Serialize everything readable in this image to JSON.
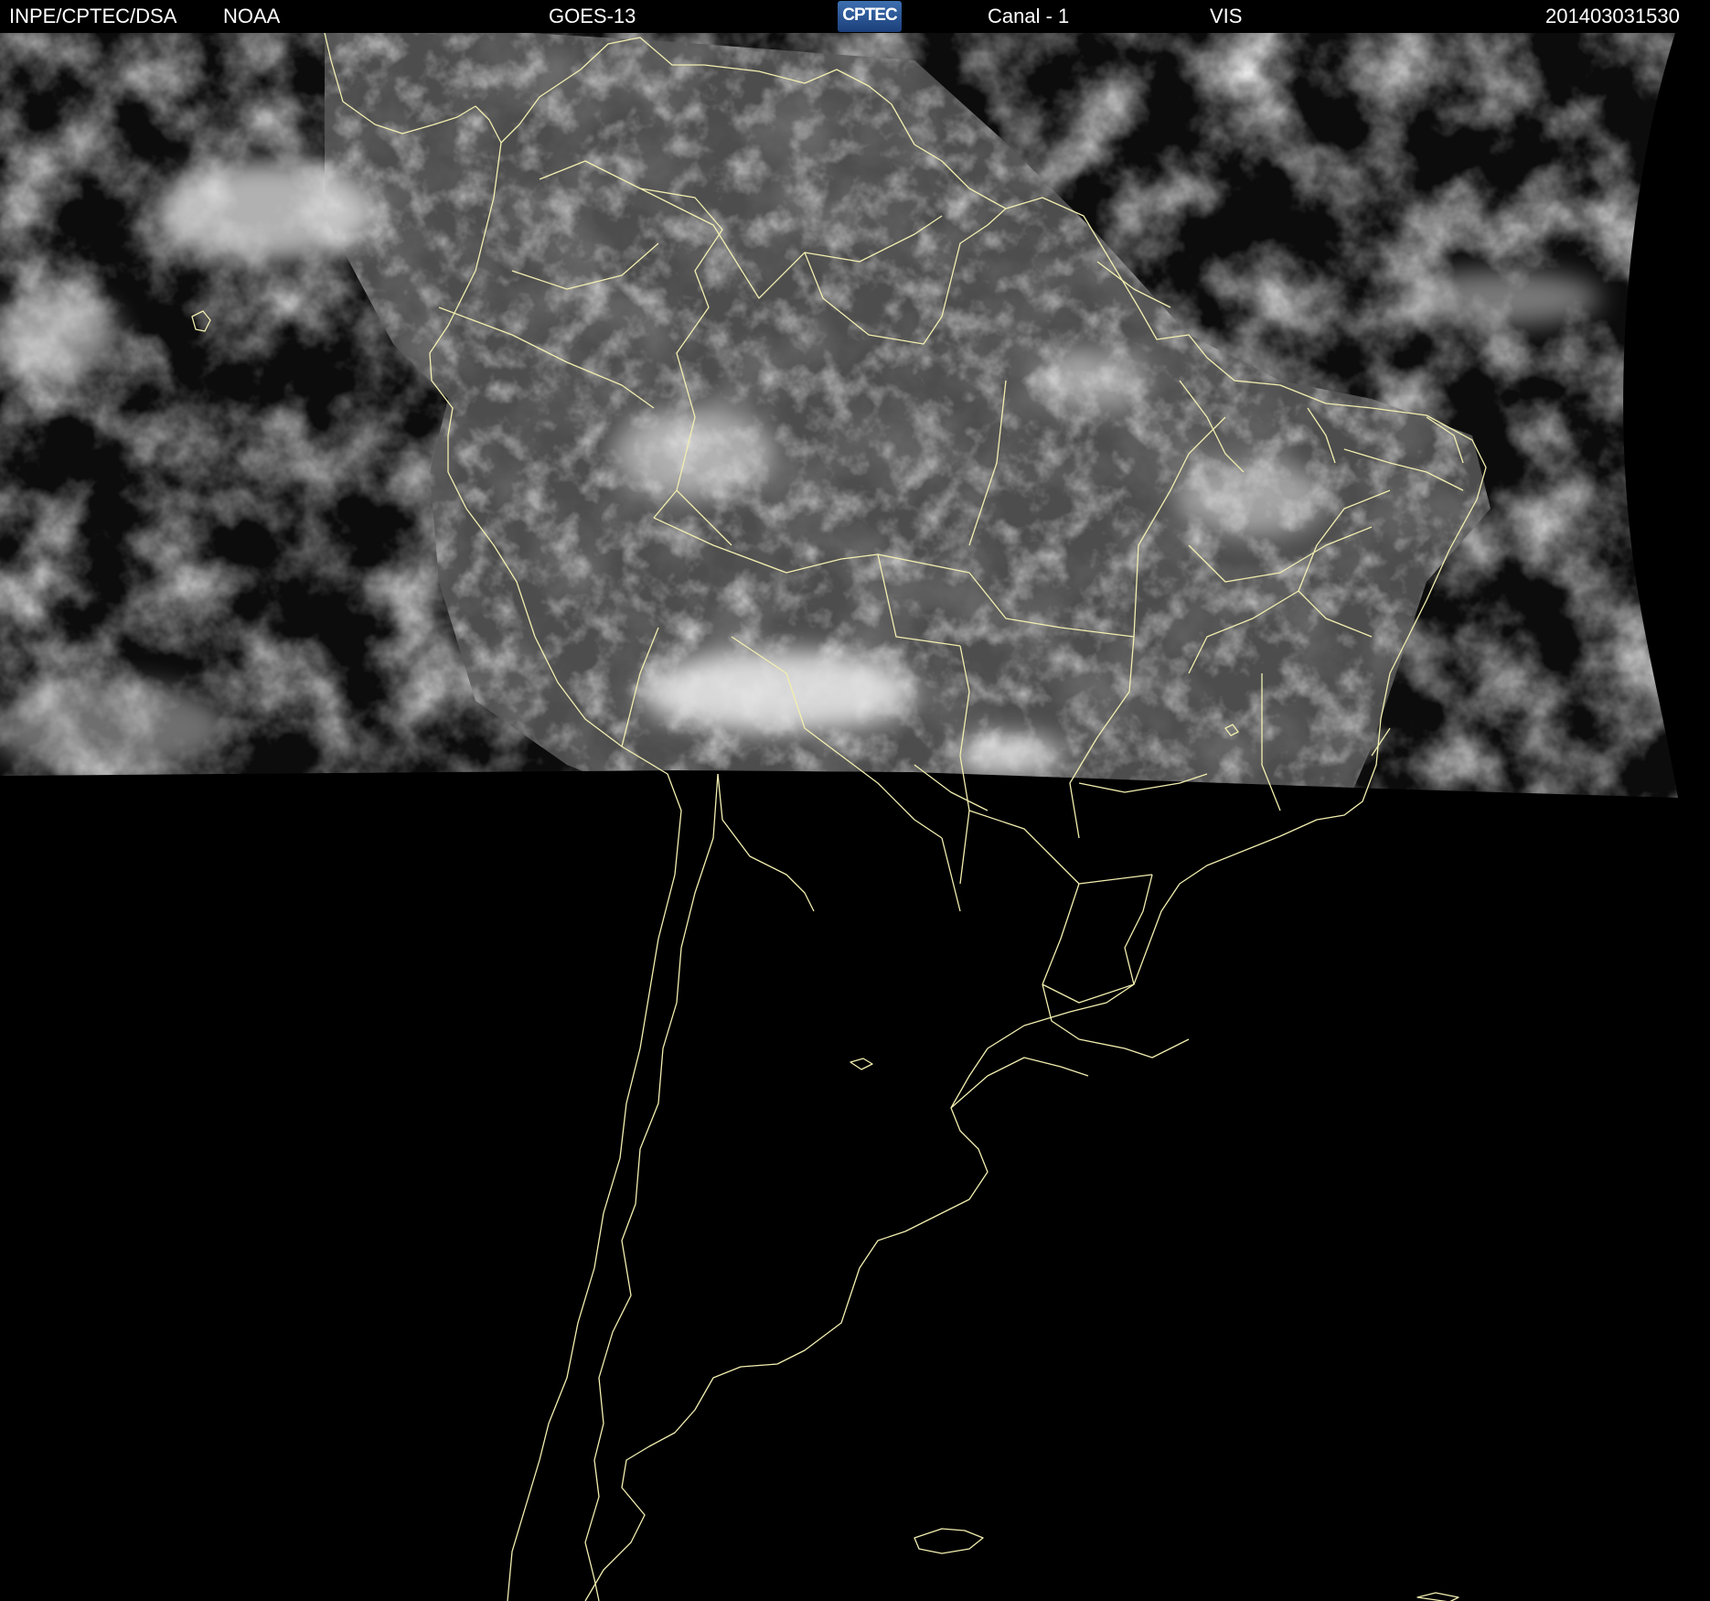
{
  "header": {
    "agency": "INPE/CPTEC/DSA",
    "source": "NOAA",
    "satellite": "GOES-13",
    "logo_text": "CPTEC",
    "channel": "Canal - 1",
    "band": "VIS",
    "timestamp": "201403031530"
  },
  "colors": {
    "background": "#000000",
    "header_text": "#ffffff",
    "coastline": "#f2efb0",
    "logo": "#2a5595"
  },
  "image": {
    "type": "satellite visible imagery",
    "coverage": "South America",
    "upper_region": "cloud imagery (daylight scan)",
    "lower_region": "no data (black) with political boundaries"
  }
}
